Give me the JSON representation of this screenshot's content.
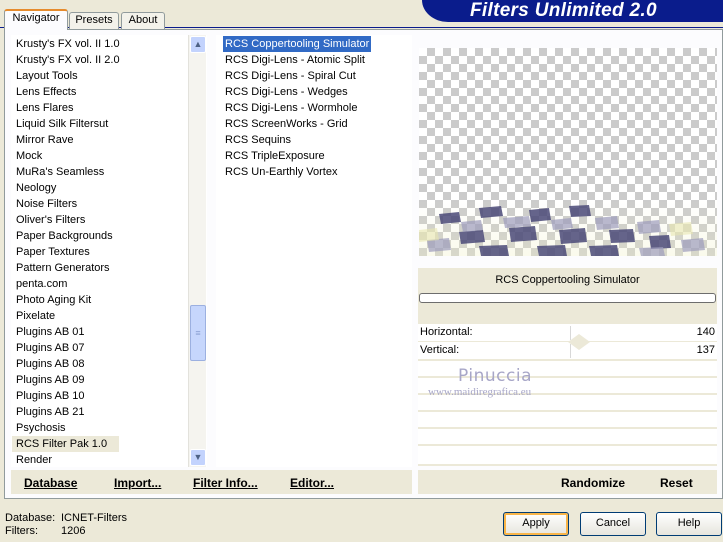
{
  "header": {
    "title": "Filters Unlimited 2.0"
  },
  "tabs": [
    {
      "label": "Navigator"
    },
    {
      "label": "Presets"
    },
    {
      "label": "About"
    }
  ],
  "categories": [
    "Krusty's FX vol. II 1.0",
    "Krusty's FX vol. II 2.0",
    "Layout Tools",
    "Lens Effects",
    "Lens Flares",
    "Liquid Silk Filtersut",
    "Mirror Rave",
    "Mock",
    "MuRa's Seamless",
    "Neology",
    "Noise Filters",
    "Oliver's Filters",
    "Paper Backgrounds",
    "Paper Textures",
    "Pattern Generators",
    "penta.com",
    "Photo Aging Kit",
    "Pixelate",
    "Plugins AB 01",
    "Plugins AB 07",
    "Plugins AB 08",
    "Plugins AB 09",
    "Plugins AB 10",
    "Plugins AB 21",
    "Psychosis",
    "RCS Filter Pak 1.0",
    "Render"
  ],
  "selected_category": "RCS Filter Pak 1.0",
  "filters": [
    "RCS Coppertooling Simulator",
    "RCS Digi-Lens - Atomic Split",
    "RCS Digi-Lens - Spiral Cut",
    "RCS Digi-Lens - Wedges",
    "RCS Digi-Lens - Wormhole",
    "RCS ScreenWorks - Grid",
    "RCS Sequins",
    "RCS TripleExposure",
    "RCS Un-Earthly Vortex"
  ],
  "selected_filter": "RCS Coppertooling Simulator",
  "params": {
    "filter_name": "RCS Coppertooling Simulator",
    "sliders": [
      {
        "label": "Horizontal:",
        "value": "140"
      },
      {
        "label": "Vertical:",
        "value": "137"
      }
    ]
  },
  "watermark": {
    "name": "Pinuccia",
    "url": "www.maidiregrafica.eu"
  },
  "left_buttons": {
    "database": "Database",
    "import": "Import...",
    "filter_info": "Filter Info...",
    "editor": "Editor..."
  },
  "right_buttons": {
    "randomize": "Randomize",
    "reset": "Reset"
  },
  "status": {
    "database_label": "Database:",
    "database_value": "ICNET-Filters",
    "filters_label": "Filters:",
    "filters_value": "1206"
  },
  "dialog_buttons": {
    "apply": "Apply",
    "cancel": "Cancel",
    "help": "Help"
  },
  "colors": {
    "banner": "#0a1c8c",
    "selection": "#316ac5",
    "face": "#ece9d8"
  }
}
